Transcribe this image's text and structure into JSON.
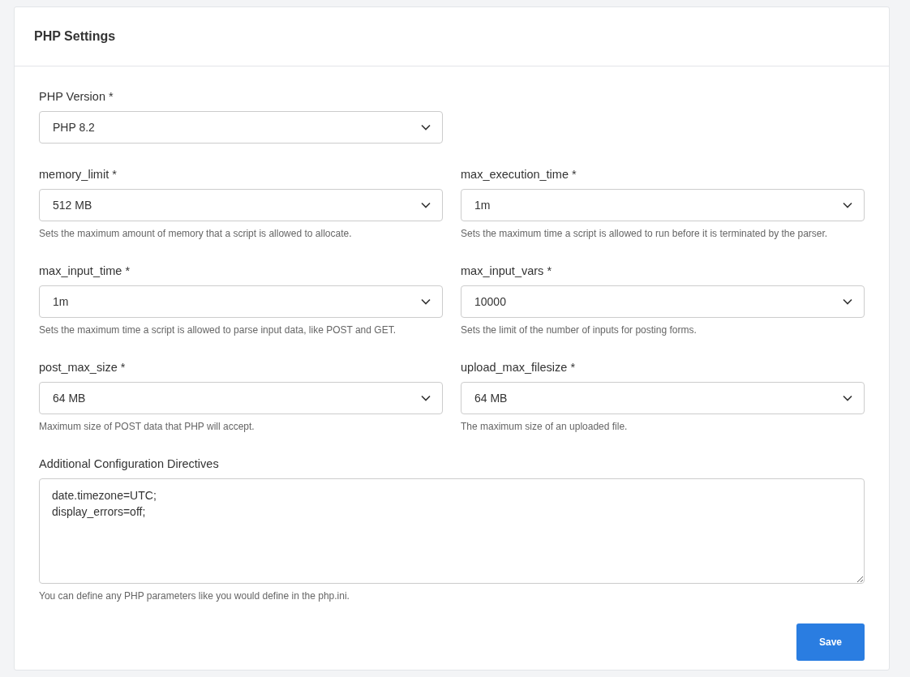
{
  "panel": {
    "title": "PHP Settings"
  },
  "rows": [
    [
      {
        "label": "PHP Version *",
        "value": "PHP 8.2"
      }
    ],
    [
      {
        "label": "memory_limit *",
        "value": "512 MB",
        "help": "Sets the maximum amount of memory that a script is allowed to allocate."
      },
      {
        "label": "max_execution_time *",
        "value": "1m",
        "help": "Sets the maximum time a script is allowed to run before it is terminated by the parser."
      }
    ],
    [
      {
        "label": "max_input_time *",
        "value": "1m",
        "help": "Sets the maximum time a script is allowed to parse input data, like POST and GET."
      },
      {
        "label": "max_input_vars *",
        "value": "10000",
        "help": "Sets the limit of the number of inputs for posting forms."
      }
    ],
    [
      {
        "label": "post_max_size *",
        "value": "64 MB",
        "help": "Maximum size of POST data that PHP will accept."
      },
      {
        "label": "upload_max_filesize *",
        "value": "64 MB",
        "help": "The maximum size of an uploaded file."
      }
    ]
  ],
  "directives": {
    "label": "Additional Configuration Directives",
    "value": "date.timezone=UTC;\ndisplay_errors=off;",
    "help": "You can define any PHP parameters like you would define in the php.ini."
  },
  "buttons": [
    "Save"
  ]
}
